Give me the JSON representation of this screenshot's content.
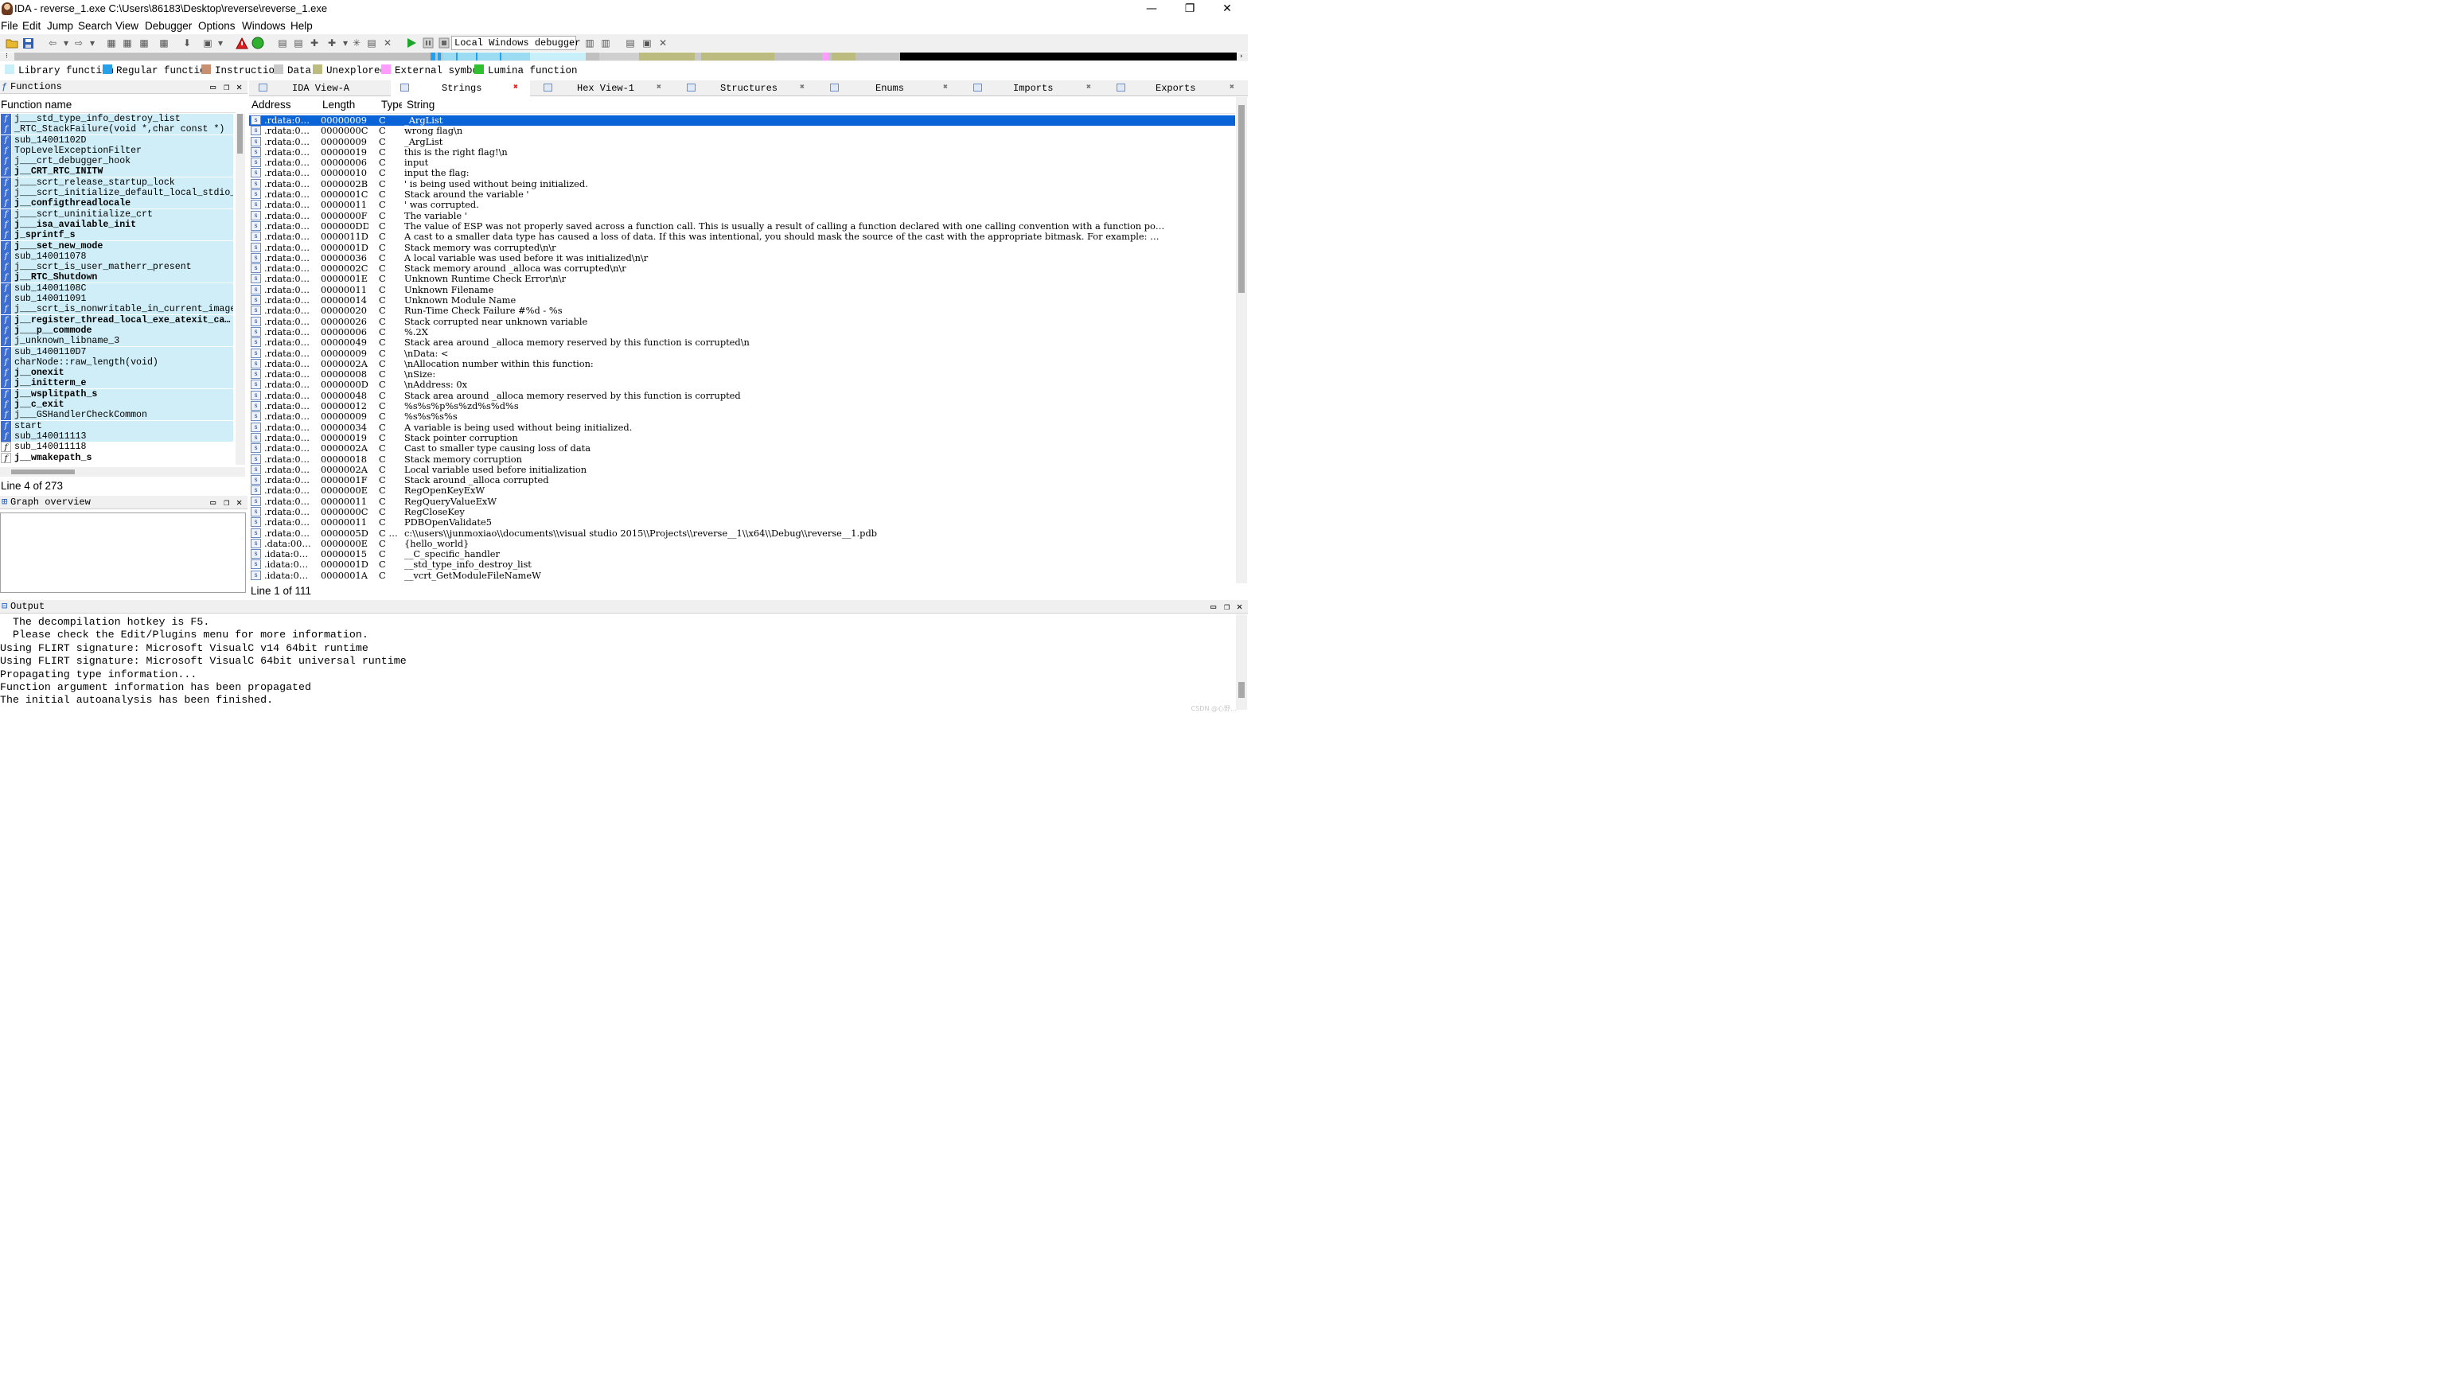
{
  "window": {
    "title": "IDA - reverse_1.exe C:\\Users\\86183\\Desktop\\reverse\\reverse_1.exe",
    "minimize": "—",
    "maximize": "❐",
    "close": "✕"
  },
  "menu": [
    "File",
    "Edit",
    "Jump",
    "Search",
    "View",
    "Debugger",
    "Options",
    "Windows",
    "Help"
  ],
  "toolbar": {
    "debugger": "Local Windows debugger"
  },
  "legend": [
    {
      "label": "Library function",
      "color": "#c8f0fa"
    },
    {
      "label": "Regular function",
      "color": "#26a0e8"
    },
    {
      "label": "Instruction",
      "color": "#c89070"
    },
    {
      "label": "Data",
      "color": "#c8c8c8"
    },
    {
      "label": "Unexplored",
      "color": "#bcbc80"
    },
    {
      "label": "External symbol",
      "color": "#ff9cff"
    },
    {
      "label": "Lumina function",
      "color": "#30c030"
    }
  ],
  "functions": {
    "title": "Functions",
    "column": "Function name",
    "status": "Line 4 of 273",
    "rows": [
      {
        "name": "j___std_type_info_destroy_list",
        "kind": "lib",
        "bold": false
      },
      {
        "name": "_RTC_StackFailure(void *,char const *)",
        "kind": "lib",
        "bold": false
      },
      {
        "name": "sub_14001102D",
        "kind": "lib",
        "bold": false
      },
      {
        "name": "TopLevelExceptionFilter",
        "kind": "lib",
        "bold": false
      },
      {
        "name": "j___crt_debugger_hook",
        "kind": "lib",
        "bold": false
      },
      {
        "name": "j__CRT_RTC_INITW",
        "kind": "lib",
        "bold": true
      },
      {
        "name": "j___scrt_release_startup_lock",
        "kind": "lib",
        "bold": false
      },
      {
        "name": "j___scrt_initialize_default_local_stdio_op…",
        "kind": "lib",
        "bold": false
      },
      {
        "name": "j__configthreadlocale",
        "kind": "lib",
        "bold": true
      },
      {
        "name": "j___scrt_uninitialize_crt",
        "kind": "lib",
        "bold": false
      },
      {
        "name": "j___isa_available_init",
        "kind": "lib",
        "bold": true
      },
      {
        "name": "j_sprintf_s",
        "kind": "lib",
        "bold": true
      },
      {
        "name": "j___set_new_mode",
        "kind": "lib",
        "bold": true
      },
      {
        "name": "sub_140011078",
        "kind": "lib",
        "bold": false
      },
      {
        "name": "j___scrt_is_user_matherr_present",
        "kind": "lib",
        "bold": false
      },
      {
        "name": "j__RTC_Shutdown",
        "kind": "lib",
        "bold": true
      },
      {
        "name": "sub_14001108C",
        "kind": "lib",
        "bold": false
      },
      {
        "name": "sub_140011091",
        "kind": "lib",
        "bold": false
      },
      {
        "name": "j___scrt_is_nonwritable_in_current_image",
        "kind": "lib",
        "bold": false
      },
      {
        "name": "j__register_thread_local_exe_atexit_ca…",
        "kind": "lib",
        "bold": true
      },
      {
        "name": "j___p__commode",
        "kind": "lib",
        "bold": true
      },
      {
        "name": "j_unknown_libname_3",
        "kind": "lib",
        "bold": false
      },
      {
        "name": "sub_1400110D7",
        "kind": "lib",
        "bold": false
      },
      {
        "name": "charNode::raw_length(void)",
        "kind": "lib",
        "bold": false
      },
      {
        "name": "j__onexit",
        "kind": "lib",
        "bold": true
      },
      {
        "name": "j__initterm_e",
        "kind": "lib",
        "bold": true
      },
      {
        "name": "j__wsplitpath_s",
        "kind": "lib",
        "bold": true
      },
      {
        "name": "j__c_exit",
        "kind": "lib",
        "bold": true
      },
      {
        "name": "j___GSHandlerCheckCommon",
        "kind": "lib",
        "bold": false
      },
      {
        "name": "start",
        "kind": "lib",
        "bold": false
      },
      {
        "name": "sub_140011113",
        "kind": "lib",
        "bold": false
      },
      {
        "name": "sub_140011118",
        "kind": "plain",
        "bold": false
      },
      {
        "name": "j__wmakepath_s",
        "kind": "plain",
        "bold": true
      }
    ]
  },
  "graph": {
    "title": "Graph overview"
  },
  "tabs": [
    {
      "label": "IDA View-A",
      "active": false
    },
    {
      "label": "Strings",
      "active": true
    },
    {
      "label": "Hex View-1",
      "active": false
    },
    {
      "label": "Structures",
      "active": false
    },
    {
      "label": "Enums",
      "active": false
    },
    {
      "label": "Imports",
      "active": false
    },
    {
      "label": "Exports",
      "active": false
    }
  ],
  "strings": {
    "columns": {
      "address": "Address",
      "length": "Length",
      "type": "Type",
      "string": "String"
    },
    "status": "Line 1 of 111",
    "rows": [
      {
        "addr": ".rdata:0…",
        "len": "00000009",
        "type": "C",
        "str": "_ArgList"
      },
      {
        "addr": ".rdata:0…",
        "len": "0000000C",
        "type": "C",
        "str": "wrong flag\\n"
      },
      {
        "addr": ".rdata:0…",
        "len": "00000009",
        "type": "C",
        "str": "_ArgList"
      },
      {
        "addr": ".rdata:0…",
        "len": "00000019",
        "type": "C",
        "str": "this is the right flag!\\n"
      },
      {
        "addr": ".rdata:0…",
        "len": "00000006",
        "type": "C",
        "str": "input"
      },
      {
        "addr": ".rdata:0…",
        "len": "00000010",
        "type": "C",
        "str": "input the flag:"
      },
      {
        "addr": ".rdata:0…",
        "len": "0000002B",
        "type": "C",
        "str": "' is being used without being initialized."
      },
      {
        "addr": ".rdata:0…",
        "len": "0000001C",
        "type": "C",
        "str": "Stack around the variable '"
      },
      {
        "addr": ".rdata:0…",
        "len": "00000011",
        "type": "C",
        "str": "' was corrupted."
      },
      {
        "addr": ".rdata:0…",
        "len": "0000000F",
        "type": "C",
        "str": "The variable '"
      },
      {
        "addr": ".rdata:0…",
        "len": "000000DD",
        "type": "C",
        "str": "The value of ESP was not properly saved across a function call.  This is usually a result of calling a function declared with one calling convention with a function po…"
      },
      {
        "addr": ".rdata:0…",
        "len": "0000011D",
        "type": "C",
        "str": "A cast to a smaller data type has caused a loss of data.  If this was intentional, you should mask the source of the cast with the appropriate bitmask.  For example: …"
      },
      {
        "addr": ".rdata:0…",
        "len": "0000001D",
        "type": "C",
        "str": "Stack memory was corrupted\\n\\r"
      },
      {
        "addr": ".rdata:0…",
        "len": "00000036",
        "type": "C",
        "str": "A local variable was used before it was initialized\\n\\r"
      },
      {
        "addr": ".rdata:0…",
        "len": "0000002C",
        "type": "C",
        "str": "Stack memory around _alloca was corrupted\\n\\r"
      },
      {
        "addr": ".rdata:0…",
        "len": "0000001E",
        "type": "C",
        "str": "Unknown Runtime Check Error\\n\\r"
      },
      {
        "addr": ".rdata:0…",
        "len": "00000011",
        "type": "C",
        "str": "Unknown Filename"
      },
      {
        "addr": ".rdata:0…",
        "len": "00000014",
        "type": "C",
        "str": "Unknown Module Name"
      },
      {
        "addr": ".rdata:0…",
        "len": "00000020",
        "type": "C",
        "str": "Run-Time Check Failure #%d - %s"
      },
      {
        "addr": ".rdata:0…",
        "len": "00000026",
        "type": "C",
        "str": "Stack corrupted near unknown variable"
      },
      {
        "addr": ".rdata:0…",
        "len": "00000006",
        "type": "C",
        "str": "%.2X "
      },
      {
        "addr": ".rdata:0…",
        "len": "00000049",
        "type": "C",
        "str": "Stack area around _alloca memory reserved by this function is corrupted\\n"
      },
      {
        "addr": ".rdata:0…",
        "len": "00000009",
        "type": "C",
        "str": "\\nData: <"
      },
      {
        "addr": ".rdata:0…",
        "len": "0000002A",
        "type": "C",
        "str": "\\nAllocation number within this function: "
      },
      {
        "addr": ".rdata:0…",
        "len": "00000008",
        "type": "C",
        "str": "\\nSize: "
      },
      {
        "addr": ".rdata:0…",
        "len": "0000000D",
        "type": "C",
        "str": "\\nAddress: 0x"
      },
      {
        "addr": ".rdata:0…",
        "len": "00000048",
        "type": "C",
        "str": "Stack area around _alloca memory reserved by this function is corrupted"
      },
      {
        "addr": ".rdata:0…",
        "len": "00000012",
        "type": "C",
        "str": "%s%s%p%s%zd%s%d%s"
      },
      {
        "addr": ".rdata:0…",
        "len": "00000009",
        "type": "C",
        "str": "%s%s%s%s"
      },
      {
        "addr": ".rdata:0…",
        "len": "00000034",
        "type": "C",
        "str": "A variable is being used without being initialized."
      },
      {
        "addr": ".rdata:0…",
        "len": "00000019",
        "type": "C",
        "str": "Stack pointer corruption"
      },
      {
        "addr": ".rdata:0…",
        "len": "0000002A",
        "type": "C",
        "str": "Cast to smaller type causing loss of data"
      },
      {
        "addr": ".rdata:0…",
        "len": "00000018",
        "type": "C",
        "str": "Stack memory corruption"
      },
      {
        "addr": ".rdata:0…",
        "len": "0000002A",
        "type": "C",
        "str": "Local variable used before initialization"
      },
      {
        "addr": ".rdata:0…",
        "len": "0000001F",
        "type": "C",
        "str": "Stack around _alloca corrupted"
      },
      {
        "addr": ".rdata:0…",
        "len": "0000000E",
        "type": "C",
        "str": "RegOpenKeyExW"
      },
      {
        "addr": ".rdata:0…",
        "len": "00000011",
        "type": "C",
        "str": "RegQueryValueExW"
      },
      {
        "addr": ".rdata:0…",
        "len": "0000000C",
        "type": "C",
        "str": "RegCloseKey"
      },
      {
        "addr": ".rdata:0…",
        "len": "00000011",
        "type": "C",
        "str": "PDBOpenValidate5"
      },
      {
        "addr": ".rdata:0…",
        "len": "0000005D",
        "type": "C …",
        "str": "c:\\\\users\\\\junmoxiao\\\\documents\\\\visual studio 2015\\\\Projects\\\\reverse__1\\\\x64\\\\Debug\\\\reverse__1.pdb"
      },
      {
        "addr": ".data:00…",
        "len": "0000000E",
        "type": "C",
        "str": "{hello_world}"
      },
      {
        "addr": ".idata:0…",
        "len": "00000015",
        "type": "C",
        "str": "__C_specific_handler"
      },
      {
        "addr": ".idata:0…",
        "len": "0000001D",
        "type": "C",
        "str": "__std_type_info_destroy_list"
      },
      {
        "addr": ".idata:0…",
        "len": "0000001A",
        "type": "C",
        "str": "__vcrt_GetModuleFileNameW"
      }
    ]
  },
  "output": {
    "title": "Output",
    "lines": [
      "  The decompilation hotkey is F5.",
      "  Please check the Edit/Plugins menu for more information.",
      "Using FLIRT signature: Microsoft VisualC v14 64bit runtime",
      "Using FLIRT signature: Microsoft VisualC 64bit universal runtime",
      "Propagating type information...",
      "Function argument information has been propagated",
      "The initial autoanalysis has been finished."
    ],
    "watermark": "CSDN @心野…"
  }
}
